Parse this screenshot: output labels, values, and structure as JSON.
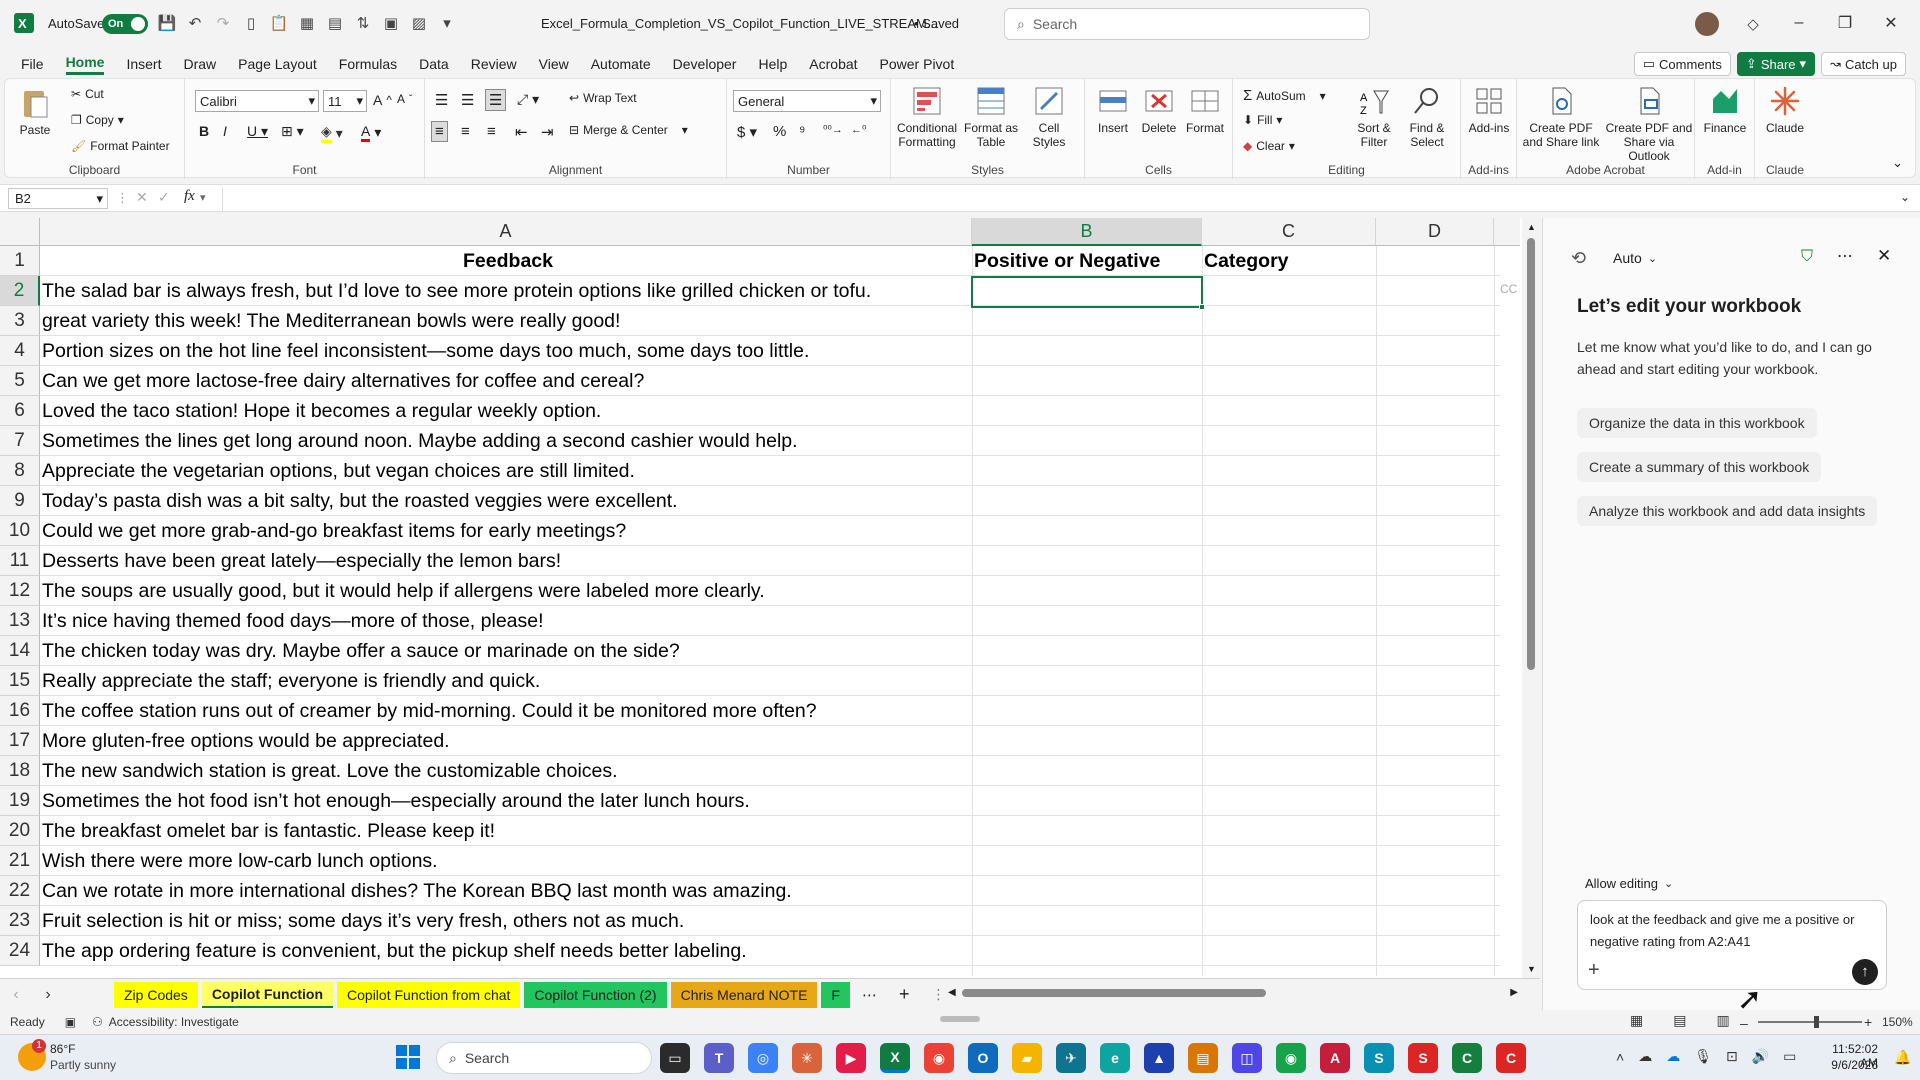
{
  "titlebar": {
    "autosave_label": "AutoSave",
    "autosave_state": "On",
    "filename": "Excel_Formula_Completion_VS_Copilot_Function_LIVE_STREAM...",
    "saved_status": "• Saved",
    "search_placeholder": "Search"
  },
  "menu": {
    "tabs": [
      "File",
      "Home",
      "Insert",
      "Draw",
      "Page Layout",
      "Formulas",
      "Data",
      "Review",
      "View",
      "Automate",
      "Developer",
      "Help",
      "Acrobat",
      "Power Pivot"
    ],
    "comments": "Comments",
    "share": "Share",
    "catchup": "Catch up"
  },
  "ribbon": {
    "clipboard": {
      "label": "Clipboard",
      "paste": "Paste",
      "cut": "Cut",
      "copy": "Copy",
      "format_painter": "Format Painter"
    },
    "font": {
      "label": "Font",
      "name": "Calibri",
      "size": "11"
    },
    "alignment": {
      "label": "Alignment",
      "wrap": "Wrap Text",
      "merge": "Merge & Center"
    },
    "number": {
      "label": "Number",
      "format": "General"
    },
    "styles": {
      "label": "Styles",
      "cond": "Conditional Formatting",
      "table": "Format as Table",
      "cell": "Cell Styles"
    },
    "cells": {
      "label": "Cells",
      "insert": "Insert",
      "delete": "Delete",
      "format": "Format"
    },
    "editing": {
      "label": "Editing",
      "autosum": "AutoSum",
      "fill": "Fill",
      "clear": "Clear",
      "sort": "Sort & Filter",
      "find": "Find & Select"
    },
    "addins": {
      "label": "Add-ins",
      "btn": "Add-ins"
    },
    "acrobat": {
      "label": "Adobe Acrobat",
      "pdf1": "Create PDF and Share link",
      "pdf2": "Create PDF and Share via Outlook"
    },
    "addin2": {
      "label": "Add-in",
      "finance": "Finance"
    },
    "claude": {
      "label": "Claude",
      "btn": "Claude"
    }
  },
  "formula": {
    "namebox": "B2",
    "fx": "fx",
    "content": ""
  },
  "grid": {
    "columns": [
      "A",
      "B",
      "C",
      "D"
    ],
    "headers": {
      "A": "Feedback",
      "B": "Positive or Negative",
      "C": "Category"
    },
    "rows": [
      {
        "n": "1"
      },
      {
        "n": "2",
        "a": "The salad bar is always fresh, but I’d love to see more protein options like grilled chicken or tofu."
      },
      {
        "n": "3",
        "a": "great  variety this week! The Mediterranean bowls were really good!"
      },
      {
        "n": "4",
        "a": "Portion sizes on the hot line feel inconsistent—some days too much, some days too little."
      },
      {
        "n": "5",
        "a": "Can we get more lactose-free dairy alternatives for coffee and cereal?"
      },
      {
        "n": "6",
        "a": "Loved the taco station! Hope it becomes a regular weekly option."
      },
      {
        "n": "7",
        "a": "Sometimes the lines get long around noon. Maybe adding a second cashier would help."
      },
      {
        "n": "8",
        "a": "Appreciate the vegetarian options, but vegan choices are still limited."
      },
      {
        "n": "9",
        "a": "Today’s pasta dish was a bit salty, but the roasted veggies were excellent."
      },
      {
        "n": "10",
        "a": "Could we get more grab-and-go breakfast items for early meetings?"
      },
      {
        "n": "11",
        "a": "Desserts have been great lately—especially the lemon bars!"
      },
      {
        "n": "12",
        "a": "The soups are usually good, but it would help if allergens were labeled more clearly."
      },
      {
        "n": "13",
        "a": "It’s nice having themed food days—more of those, please!"
      },
      {
        "n": "14",
        "a": "The chicken today was dry. Maybe offer a sauce or marinade on the side?"
      },
      {
        "n": "15",
        "a": "Really appreciate the staff; everyone is friendly and quick."
      },
      {
        "n": "16",
        "a": "The coffee station runs out of creamer by mid-morning. Could it be monitored more often?"
      },
      {
        "n": "17",
        "a": "More gluten-free options would be appreciated."
      },
      {
        "n": "18",
        "a": "The new sandwich station is great. Love the customizable choices."
      },
      {
        "n": "19",
        "a": "Sometimes the hot food isn’t hot enough—especially around the later lunch hours."
      },
      {
        "n": "20",
        "a": "The breakfast omelet bar is fantastic. Please keep it!"
      },
      {
        "n": "21",
        "a": "Wish there were more low-carb lunch options."
      },
      {
        "n": "22",
        "a": "Can we rotate in more international dishes? The Korean BBQ last month was amazing."
      },
      {
        "n": "23",
        "a": "Fruit selection is hit or miss; some days it’s very fresh, others not as much."
      },
      {
        "n": "24",
        "a": "The app ordering feature is convenient, but the pickup shelf needs better labeling."
      }
    ],
    "overflow_hint": "CC"
  },
  "sheets": [
    {
      "name": "Zip Codes",
      "color": "#ffff00"
    },
    {
      "name": "Copilot Function",
      "color": "#ffff66",
      "active": true
    },
    {
      "name": "Copilot Function from chat",
      "color": "#ffff00"
    },
    {
      "name": "Copilot Function (2)",
      "color": "#22c55e"
    },
    {
      "name": "Chris Menard NOTE",
      "color": "#e6a817"
    },
    {
      "name": "F",
      "color": "#22c55e"
    }
  ],
  "status": {
    "ready": "Ready",
    "accessibility": "Accessibility: Investigate",
    "zoom": "150%"
  },
  "copilot": {
    "mode": "Auto",
    "title": "Let’s edit your workbook",
    "intro": "Let me know what you’d like to do, and I can go ahead and start editing your workbook.",
    "suggestions": [
      "Organize the data in this workbook",
      "Create a summary of this workbook",
      "Analyze this workbook and add data insights"
    ],
    "allow_editing": "Allow editing",
    "input_text": "look at the feedback and give me a positive or negative rating from A2:A41"
  },
  "taskbar": {
    "temp": "86°F",
    "weather": "Partly sunny",
    "badge": "1",
    "search": "Search",
    "time": "11:52:02 AM",
    "date": "9/6/2026"
  }
}
